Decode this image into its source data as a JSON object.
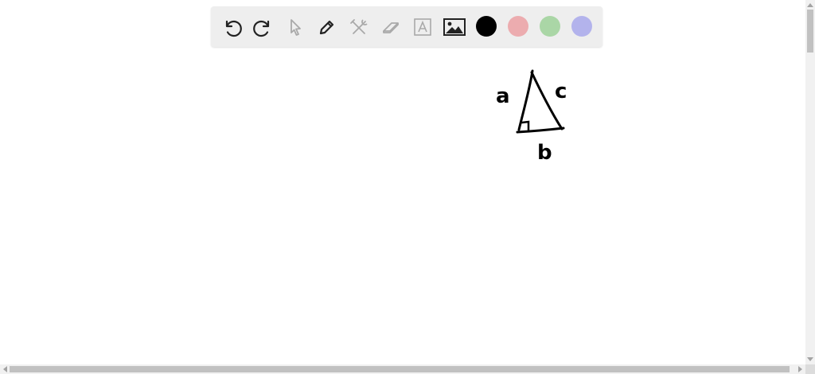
{
  "toolbar": {
    "tools": [
      {
        "name": "undo-icon",
        "enabled": true
      },
      {
        "name": "redo-icon",
        "enabled": true
      },
      {
        "name": "select-pointer-icon",
        "enabled": false
      },
      {
        "name": "pen-icon",
        "enabled": true
      },
      {
        "name": "tools-icon",
        "enabled": false
      },
      {
        "name": "eraser-icon",
        "enabled": false
      },
      {
        "name": "text-icon",
        "enabled": false
      },
      {
        "name": "image-icon",
        "enabled": true
      }
    ],
    "colors": [
      {
        "name": "black",
        "hex": "#000000"
      },
      {
        "name": "red",
        "hex": "#ecacaf"
      },
      {
        "name": "green",
        "hex": "#aad6a6"
      },
      {
        "name": "blue",
        "hex": "#b3b3ec"
      }
    ]
  },
  "drawing": {
    "labels": {
      "a": "a",
      "b": "b",
      "c": "c"
    }
  },
  "colors": {
    "toolbar_bg": "#eeeeee",
    "icon_active": "#222222",
    "icon_disabled": "#a9a9a9",
    "ink": "#000000"
  }
}
